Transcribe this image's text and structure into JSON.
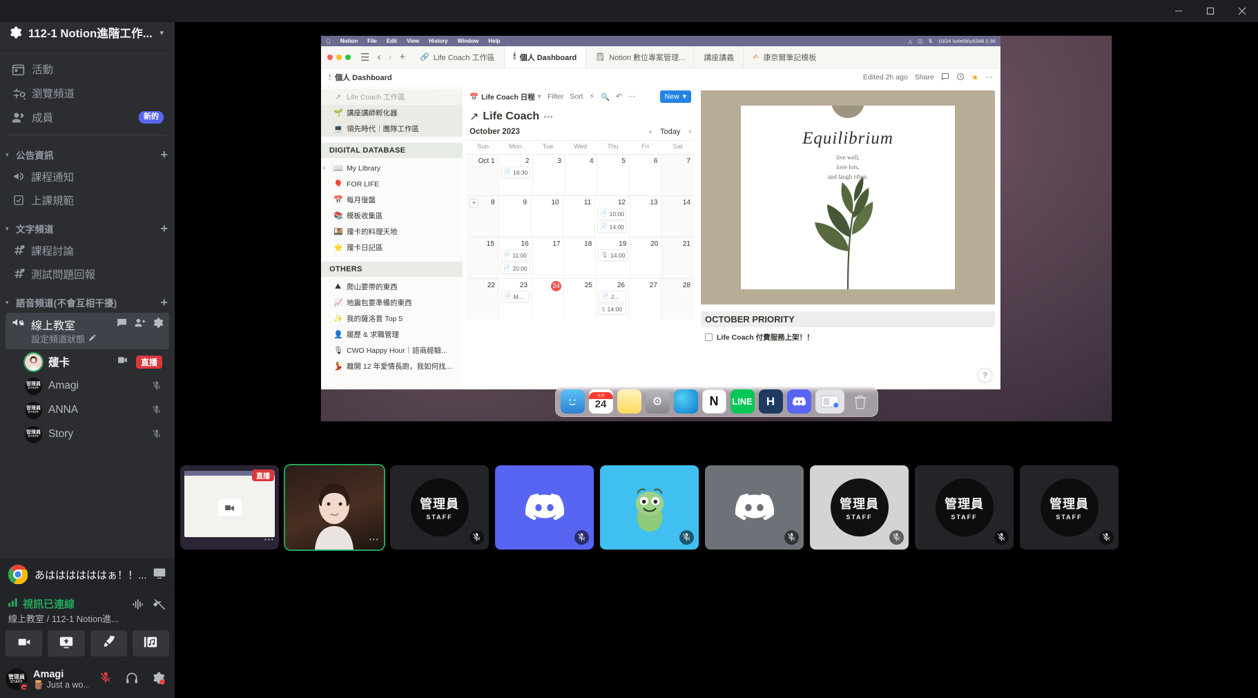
{
  "window": {
    "minimize": "—",
    "maximize": "□",
    "close": "✕"
  },
  "sidebar": {
    "server_name": "112-1 Notion進階工作...",
    "nav": [
      {
        "label": "活動",
        "icon": "calendar-icon",
        "badge": ""
      },
      {
        "label": "瀏覽頻道",
        "icon": "compass-search-icon",
        "badge": ""
      },
      {
        "label": "成員",
        "icon": "members-icon",
        "badge": "新的"
      }
    ],
    "categories": [
      {
        "name": "公告資訊",
        "channels": [
          {
            "label": "課程通知",
            "icon": "announcement-icon"
          },
          {
            "label": "上課規範",
            "icon": "rules-icon"
          }
        ]
      },
      {
        "name": "文字頻道",
        "channels": [
          {
            "label": "課程討論",
            "icon": "hash-lock-icon"
          },
          {
            "label": "測試問題回報",
            "icon": "hash-lock-icon"
          }
        ]
      },
      {
        "name": "語音頻道(不會互相干擾)",
        "channels": []
      }
    ],
    "voice_channel": {
      "name": "線上教室",
      "status_prompt": "設定頻道狀態",
      "members": [
        {
          "name": "蕿卡",
          "live": "直播",
          "video": true,
          "muted": false,
          "speaking": true
        },
        {
          "name": "Amagi",
          "live": "",
          "video": false,
          "muted": true,
          "speaking": false
        },
        {
          "name": "ANNA",
          "live": "",
          "video": false,
          "muted": true,
          "speaking": false
        },
        {
          "name": "Story",
          "live": "",
          "video": false,
          "muted": true,
          "speaking": false
        }
      ]
    },
    "activity": {
      "text": "あははははははぁ！！...",
      "icon": "chrome-icon"
    },
    "voice_connected": {
      "status": "視訊已連線",
      "route": "線上教室 / 112-1 Notion進...",
      "buttons": [
        {
          "name": "camera-button",
          "icon": "camera-icon"
        },
        {
          "name": "screenshare-button",
          "icon": "screen-share-icon"
        },
        {
          "name": "activities-button",
          "icon": "rocket-icon"
        },
        {
          "name": "soundboard-button",
          "icon": "soundboard-icon"
        }
      ]
    },
    "user": {
      "name": "Amagi",
      "status": "Just a wo...",
      "status_emoji": "🪵",
      "badge": "管理員",
      "badge_sub": "STAFF"
    }
  },
  "share": {
    "mac_menu": {
      "app": "Notion",
      "items": [
        "File",
        "Edit",
        "View",
        "History",
        "Window",
        "Help"
      ]
    },
    "notion_tabs": [
      {
        "label": "Life Coach 工作區",
        "emoji": "🔗",
        "active": false
      },
      {
        "label": "個人 Dashboard",
        "emoji": "🕯",
        "active": true
      },
      {
        "label": "Notion 數位專案管理...",
        "emoji": "🗒",
        "active": false
      },
      {
        "label": "講座講義",
        "emoji": "",
        "active": false
      },
      {
        "label": "康奈爾筆記模板",
        "emoji": "✍",
        "active": false
      }
    ],
    "breadcrumb": {
      "emoji": "🕯",
      "label": "個人 Dashboard"
    },
    "topbar_right": {
      "edited": "Edited 2h ago",
      "share": "Share"
    },
    "notion_sidebar": {
      "top_items": [
        {
          "emoji": "🌱",
          "label": "講座講師孵化器"
        },
        {
          "emoji": "💻",
          "label": "領先時代｜團隊工作區"
        }
      ],
      "sections": [
        {
          "title": "DIGITAL DATABASE",
          "items": [
            {
              "emoji": "📖",
              "label": "My Library"
            },
            {
              "emoji": "🎈",
              "label": "FOR LIFE"
            },
            {
              "emoji": "📅",
              "label": "每月復盤"
            },
            {
              "emoji": "📚",
              "label": "模板收集區"
            },
            {
              "emoji": "🍱",
              "label": "蕿卡的料理天地"
            },
            {
              "emoji": "⭐",
              "label": "蕿卡日記區"
            }
          ]
        },
        {
          "title": "OTHERS",
          "items": [
            {
              "emoji": "⛰",
              "label": "爬山要帶的東西"
            },
            {
              "emoji": "📈",
              "label": "地震包要準備的東西"
            },
            {
              "emoji": "✨",
              "label": "我的薩洛普 Top 5"
            },
            {
              "emoji": "👤",
              "label": "履歷 & 求職管理"
            },
            {
              "emoji": "🎙",
              "label": "CWO Happy Hour｜諮商經驗..."
            },
            {
              "emoji": "💃",
              "label": "離開 12 年愛情長跑，我如何找..."
            }
          ]
        }
      ]
    },
    "calendar": {
      "db_name": "Life Coach 日程",
      "toolbar": [
        "Filter",
        "Sort"
      ],
      "new_button": "New",
      "page_title": "Life Coach",
      "month": "October 2023",
      "today_label": "Today",
      "weekdays": [
        "Sun",
        "Mon",
        "Tue",
        "Wed",
        "Thu",
        "Fri",
        "Sat"
      ],
      "weeks": [
        [
          {
            "d": "Oct 1",
            "events": []
          },
          {
            "d": "2",
            "events": [
              {
                "icon": "doc",
                "text": "16:30"
              }
            ]
          },
          {
            "d": "3",
            "events": []
          },
          {
            "d": "4",
            "events": []
          },
          {
            "d": "5",
            "events": []
          },
          {
            "d": "6",
            "events": []
          },
          {
            "d": "7",
            "events": []
          }
        ],
        [
          {
            "d": "8",
            "events": [],
            "plus": true
          },
          {
            "d": "9",
            "events": []
          },
          {
            "d": "10",
            "events": []
          },
          {
            "d": "11",
            "events": []
          },
          {
            "d": "12",
            "events": [
              {
                "icon": "doc",
                "text": "10:00"
              },
              {
                "icon": "doc",
                "text": "14:00"
              }
            ]
          },
          {
            "d": "13",
            "events": []
          },
          {
            "d": "14",
            "events": []
          }
        ],
        [
          {
            "d": "15",
            "events": []
          },
          {
            "d": "16",
            "events": [
              {
                "icon": "doc",
                "text": "11:00"
              },
              {
                "icon": "doc",
                "text": "20:00"
              }
            ]
          },
          {
            "d": "17",
            "events": []
          },
          {
            "d": "18",
            "events": []
          },
          {
            "d": "19",
            "events": [
              {
                "icon": "mic",
                "text": "14:00"
              }
            ]
          },
          {
            "d": "20",
            "events": []
          },
          {
            "d": "21",
            "events": []
          }
        ],
        [
          {
            "d": "22",
            "events": []
          },
          {
            "d": "23",
            "events": [
              {
                "icon": "doc",
                "text": "M..."
              }
            ]
          },
          {
            "d": "24",
            "events": [],
            "today": true
          },
          {
            "d": "25",
            "events": []
          },
          {
            "d": "26",
            "events": [
              {
                "icon": "doc",
                "text": "J..."
              },
              {
                "icon": "s",
                "text": "14:00"
              }
            ]
          },
          {
            "d": "27",
            "events": []
          },
          {
            "d": "28",
            "events": []
          }
        ]
      ]
    },
    "poster": {
      "title": "Equilibrium",
      "lines": [
        "live well,",
        "love lots,",
        "and laugh often."
      ]
    },
    "priority": {
      "heading": "OCTOBER PRIORITY",
      "items": [
        {
          "label": "Life Coach 付費服務上架！！",
          "checked": false
        }
      ]
    },
    "help_fab": "?",
    "dock": [
      {
        "name": "finder-icon",
        "glyph": "🙂",
        "color": "#3fa9f5"
      },
      {
        "name": "calendar-icon",
        "glyph": "24",
        "color": "#ffffff"
      },
      {
        "name": "notes-icon",
        "glyph": "",
        "color": "#fcd34d"
      },
      {
        "name": "settings-icon",
        "glyph": "⚙",
        "color": "#8e8e93"
      },
      {
        "name": "edge-icon",
        "glyph": "",
        "color": "#0b78d0"
      },
      {
        "name": "notion-icon",
        "glyph": "N",
        "color": "#ffffff"
      },
      {
        "name": "line-icon",
        "glyph": "",
        "color": "#06c755"
      },
      {
        "name": "hackmd-icon",
        "glyph": "H",
        "color": "#1e3a5f"
      },
      {
        "name": "discord-icon",
        "glyph": "",
        "color": "#5865f2"
      },
      {
        "name": "screenshot-icon",
        "glyph": "",
        "color": "#d9d9de"
      },
      {
        "name": "trash-icon",
        "glyph": "",
        "color": "#c7c7cc"
      }
    ]
  },
  "participants": [
    {
      "type": "screen",
      "name": "screen-share-tile",
      "live": "直播",
      "label": "",
      "muted": false,
      "selected": false
    },
    {
      "type": "video",
      "name": "蕿卡",
      "live": "",
      "label": "",
      "muted": false,
      "selected": true
    },
    {
      "type": "avatar",
      "name": "管理員",
      "sub": "STAFF",
      "muted": true,
      "bg": "#232428",
      "selected": false
    },
    {
      "type": "discord",
      "name": "discord-avatar",
      "muted": true,
      "bg": "#5865f2",
      "selected": false
    },
    {
      "type": "frog",
      "name": "frog-avatar",
      "muted": true,
      "bg": "#3fc0f0",
      "selected": false
    },
    {
      "type": "discord",
      "name": "discord-avatar",
      "muted": true,
      "bg": "#6d7278",
      "selected": false
    },
    {
      "type": "avatar",
      "name": "管理員",
      "sub": "STAFF",
      "muted": true,
      "bg": "#d4d4d4",
      "dark": true,
      "selected": false
    },
    {
      "type": "avatar",
      "name": "管理員",
      "sub": "STAFF",
      "muted": true,
      "bg": "#232428",
      "selected": false
    },
    {
      "type": "avatar",
      "name": "管理員",
      "sub": "STAFF",
      "muted": true,
      "bg": "#232428",
      "selected": false
    }
  ]
}
